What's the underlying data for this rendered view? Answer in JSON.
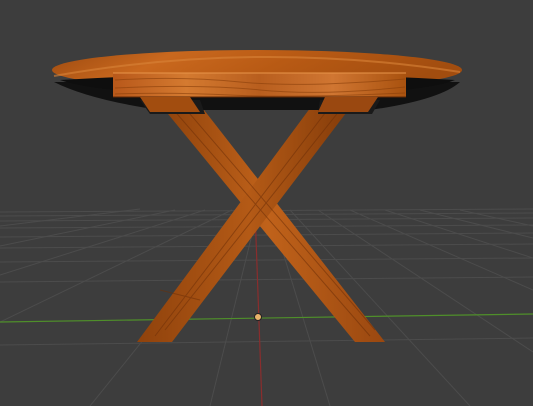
{
  "viewport": {
    "background_color": "#3d3d3d",
    "grid_color": "#4d4d4d",
    "x_axis_color": "#4f8f2a",
    "y_axis_color": "#8a2d2d",
    "origin_marker_color": "#e8b26a"
  },
  "scene": {
    "object": "round-wooden-table",
    "wood_colors": {
      "light": "#c96a1c",
      "mid": "#a9520f",
      "dark": "#6e2f08",
      "grain": "#e08a3a"
    },
    "shadow_color": "#111111"
  }
}
